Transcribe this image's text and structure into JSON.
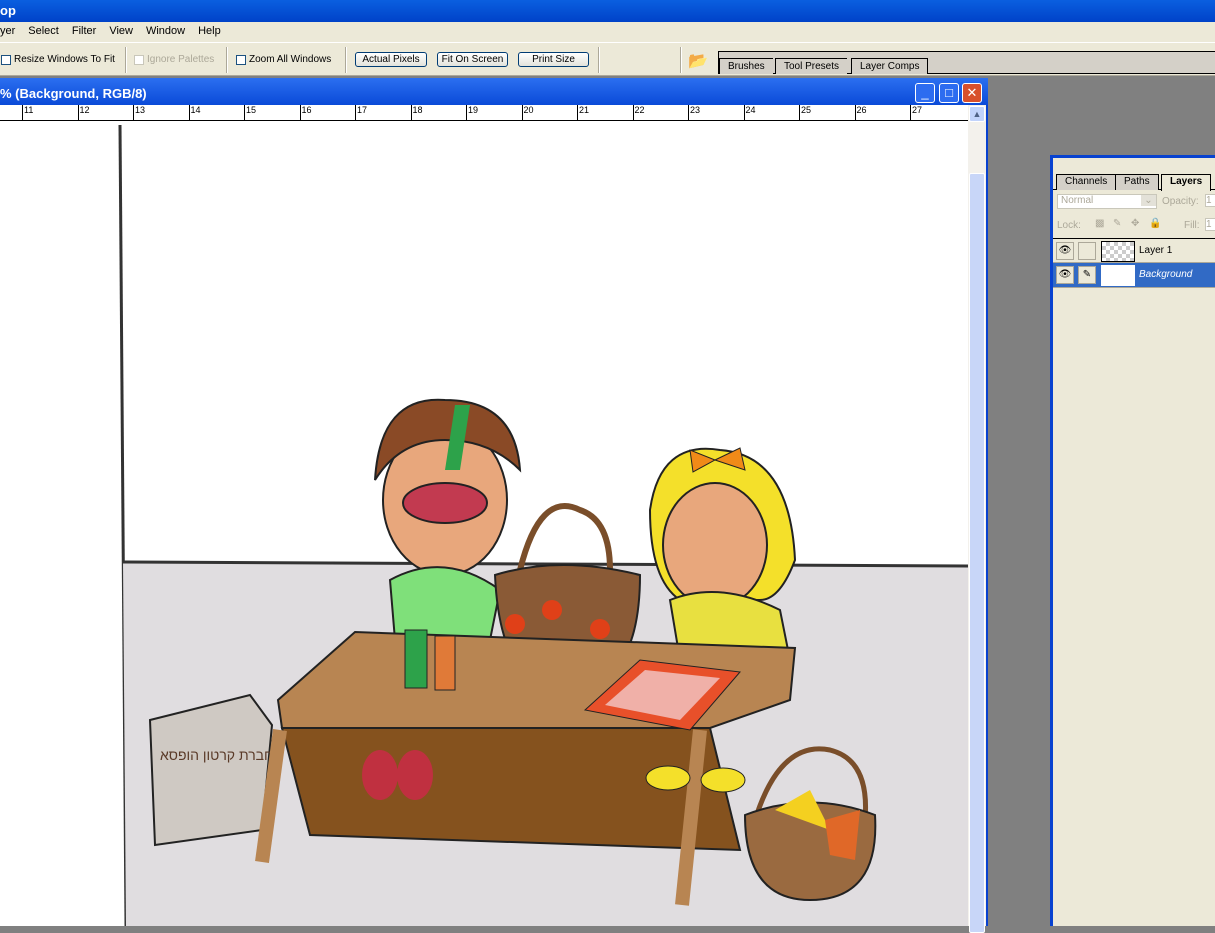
{
  "app": {
    "title": "op"
  },
  "menu": [
    "yer",
    "Select",
    "Filter",
    "View",
    "Window",
    "Help"
  ],
  "options": {
    "resize_windows": "Resize Windows To Fit",
    "ignore_palettes": "Ignore Palettes",
    "zoom_all": "Zoom All Windows",
    "actual_pixels": "Actual Pixels",
    "fit_on_screen": "Fit On Screen",
    "print_size": "Print Size"
  },
  "palette_well": {
    "tabs": [
      "Brushes",
      "Tool Presets",
      "Layer Comps"
    ]
  },
  "document": {
    "title": "% (Background, RGB/8)",
    "ruler": [
      "11",
      "12",
      "13",
      "14",
      "15",
      "16",
      "17",
      "18",
      "19",
      "20",
      "21",
      "22",
      "23",
      "24",
      "25",
      "26",
      "27"
    ]
  },
  "layers_panel": {
    "tabs": [
      "Channels",
      "Paths",
      "Layers"
    ],
    "blend_mode": "Normal",
    "opacity_label": "Opacity:",
    "opacity_value": "1",
    "lock_label": "Lock:",
    "fill_label": "Fill:",
    "fill_value": "1",
    "layers": [
      {
        "name": "Layer 1",
        "visible": true,
        "selected": false
      },
      {
        "name": "Background",
        "visible": true,
        "selected": true
      }
    ]
  },
  "artwork": {
    "box_text": "חברת קרטון הופסא"
  }
}
